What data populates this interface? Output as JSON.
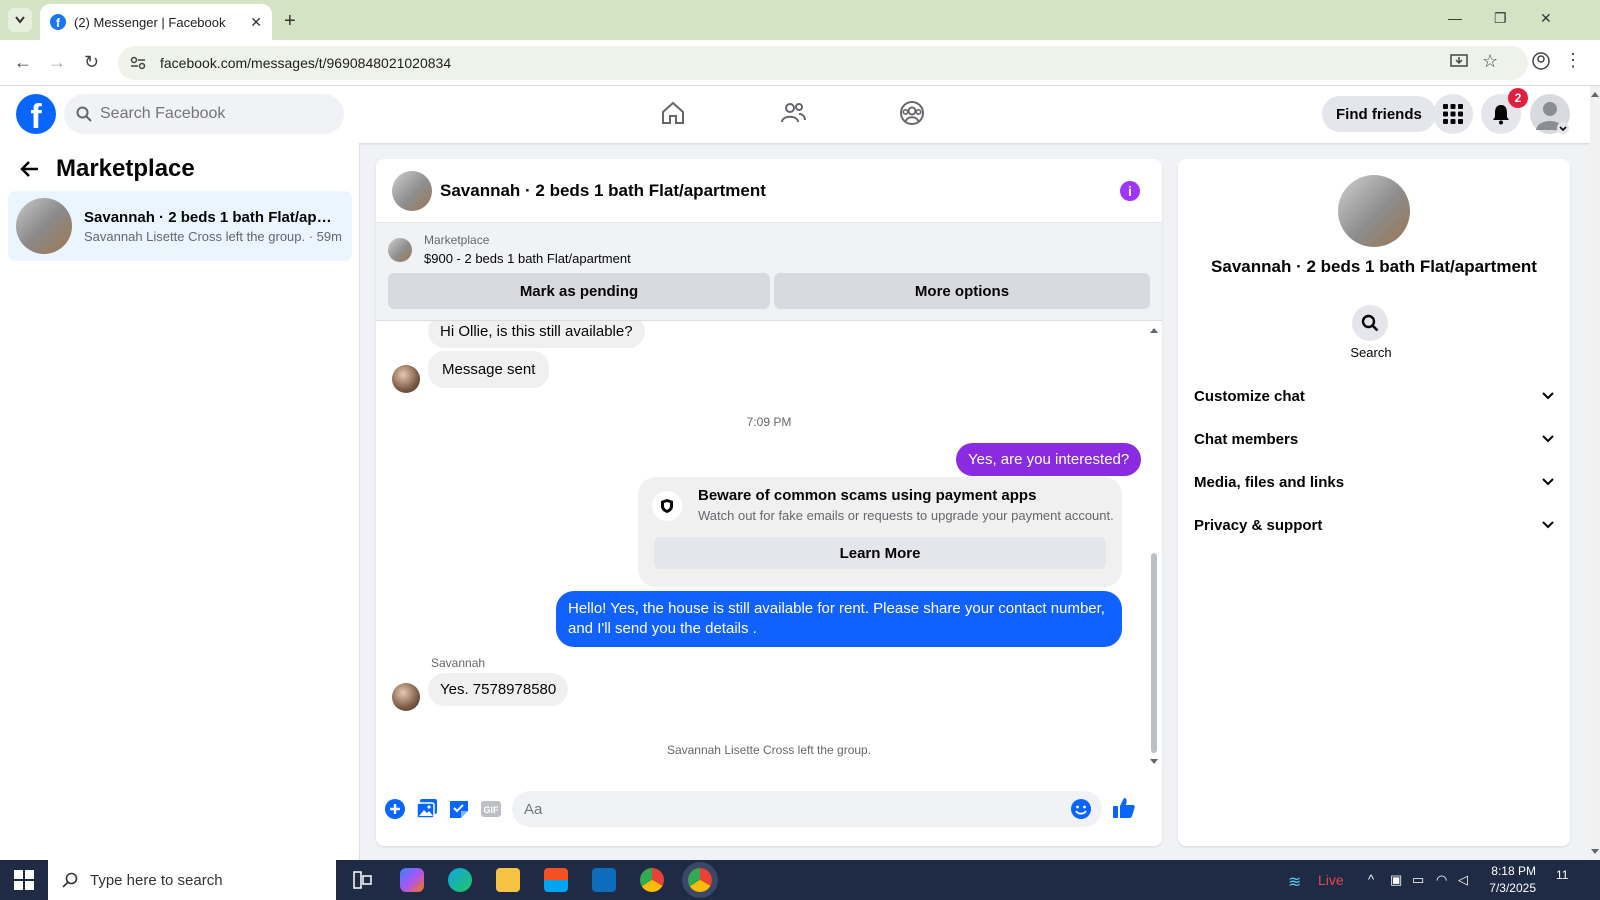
{
  "browser": {
    "tab_title": "(2) Messenger | Facebook",
    "url": "facebook.com/messages/t/9690848021020834"
  },
  "fb": {
    "search_placeholder": "Search Facebook",
    "find_friends": "Find friends",
    "notification_count": "2"
  },
  "sidebar": {
    "title": "Marketplace",
    "conversation": {
      "name": "Savannah · 2 beds 1 bath Flat/apar...",
      "preview": "Savannah Lisette Cross left the group. · 59m"
    }
  },
  "chat": {
    "title": "Savannah · 2 beds 1 bath Flat/apartment",
    "marketplace_label": "Marketplace",
    "listing": "$900 - 2 beds 1 bath Flat/apartment",
    "mark_pending": "Mark as pending",
    "more_options": "More options",
    "messages": {
      "m1": "Hi Ollie, is this still available?",
      "m2": "Message sent",
      "timestamp": "7:09 PM",
      "m3": "Yes, are you interested?",
      "scam_title": "Beware of common scams using payment apps",
      "scam_desc": "Watch out for fake emails or requests to upgrade your payment account.",
      "learn_more": "Learn More",
      "m4": "Hello! Yes, the house is still available for rent. Please share your contact number, and I'll send you the details .",
      "sender_name": "Savannah",
      "m5": "Yes. 7578978580",
      "system": "Savannah Lisette Cross left the group."
    },
    "composer_placeholder": "Aa"
  },
  "details": {
    "title": "Savannah · 2 beds 1 bath Flat/apartment",
    "search_label": "Search",
    "sections": [
      "Customize chat",
      "Chat members",
      "Media, files and links",
      "Privacy & support"
    ]
  },
  "taskbar": {
    "search_placeholder": "Type here to search",
    "live": "Live",
    "time": "8:18 PM",
    "date": "7/3/2025",
    "notif": "11"
  },
  "colors": {
    "fb_blue": "#0866ff",
    "messenger_purple": "#a033ff",
    "out_bubble_purple": "#8a2be2",
    "out_bubble_blue": "#1161ff"
  }
}
